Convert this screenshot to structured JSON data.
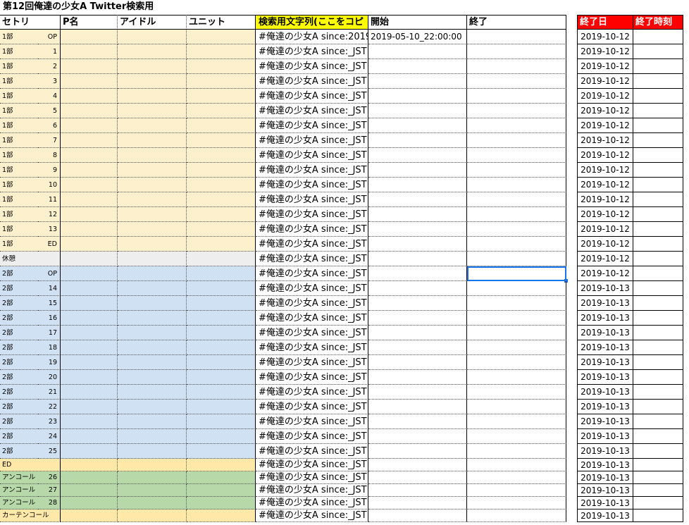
{
  "title": "第12回俺達の少女A Twitter検索用",
  "headers": {
    "setlist": "セトリ",
    "producer": "P名",
    "idol": "アイドル",
    "unit": "ユニット",
    "search": "検索用文字列(ここをコピ",
    "start": "開始",
    "end": "終了",
    "end_date": "終了日",
    "end_time": "終了時刻"
  },
  "search_first": "#俺達の少女A since:2019-",
  "search_rest": "#俺達の少女A since:_JST",
  "start_first": "2019-05-10_22:00:00",
  "rows": [
    {
      "part": "1部",
      "num": "OP",
      "band": "orange",
      "end_date": "2019-10-12"
    },
    {
      "part": "1部",
      "num": "1",
      "band": "orange",
      "end_date": "2019-10-12"
    },
    {
      "part": "1部",
      "num": "2",
      "band": "orange",
      "end_date": "2019-10-12"
    },
    {
      "part": "1部",
      "num": "3",
      "band": "orange",
      "end_date": "2019-10-12"
    },
    {
      "part": "1部",
      "num": "4",
      "band": "orange",
      "end_date": "2019-10-12"
    },
    {
      "part": "1部",
      "num": "5",
      "band": "orange",
      "end_date": "2019-10-12"
    },
    {
      "part": "1部",
      "num": "6",
      "band": "orange",
      "end_date": "2019-10-12"
    },
    {
      "part": "1部",
      "num": "7",
      "band": "orange",
      "end_date": "2019-10-12"
    },
    {
      "part": "1部",
      "num": "8",
      "band": "orange",
      "end_date": "2019-10-12"
    },
    {
      "part": "1部",
      "num": "9",
      "band": "orange",
      "end_date": "2019-10-12"
    },
    {
      "part": "1部",
      "num": "10",
      "band": "orange",
      "end_date": "2019-10-12"
    },
    {
      "part": "1部",
      "num": "11",
      "band": "orange",
      "end_date": "2019-10-12"
    },
    {
      "part": "1部",
      "num": "12",
      "band": "orange",
      "end_date": "2019-10-12"
    },
    {
      "part": "1部",
      "num": "13",
      "band": "orange",
      "end_date": "2019-10-12"
    },
    {
      "part": "1部",
      "num": "ED",
      "band": "orange",
      "end_date": "2019-10-12"
    },
    {
      "part": "休憩",
      "num": "",
      "band": "gray",
      "end_date": "2019-10-12"
    },
    {
      "part": "2部",
      "num": "OP",
      "band": "blue",
      "end_date": "2019-10-12"
    },
    {
      "part": "2部",
      "num": "14",
      "band": "blue",
      "end_date": "2019-10-13"
    },
    {
      "part": "2部",
      "num": "15",
      "band": "blue",
      "end_date": "2019-10-13"
    },
    {
      "part": "2部",
      "num": "16",
      "band": "blue",
      "end_date": "2019-10-13"
    },
    {
      "part": "2部",
      "num": "17",
      "band": "blue",
      "end_date": "2019-10-13"
    },
    {
      "part": "2部",
      "num": "18",
      "band": "blue",
      "end_date": "2019-10-13"
    },
    {
      "part": "2部",
      "num": "19",
      "band": "blue",
      "end_date": "2019-10-13"
    },
    {
      "part": "2部",
      "num": "20",
      "band": "blue",
      "end_date": "2019-10-13"
    },
    {
      "part": "2部",
      "num": "21",
      "band": "blue",
      "end_date": "2019-10-13"
    },
    {
      "part": "2部",
      "num": "22",
      "band": "blue",
      "end_date": "2019-10-13"
    },
    {
      "part": "2部",
      "num": "23",
      "band": "blue",
      "end_date": "2019-10-13"
    },
    {
      "part": "2部",
      "num": "24",
      "band": "blue",
      "end_date": "2019-10-13"
    },
    {
      "part": "2部",
      "num": "25",
      "band": "blue",
      "end_date": "2019-10-13"
    },
    {
      "part": "ED",
      "num": "",
      "band": "yellow",
      "end_date": "2019-10-13"
    },
    {
      "part": "アンコール",
      "num": "26",
      "band": "green",
      "end_date": "2019-10-13"
    },
    {
      "part": "アンコール",
      "num": "27",
      "band": "green",
      "end_date": "2019-10-13"
    },
    {
      "part": "アンコール",
      "num": "28",
      "band": "green",
      "end_date": "2019-10-13"
    },
    {
      "part": "カーテンコール",
      "num": "",
      "band": "yellow",
      "end_date": "2019-10-13"
    }
  ],
  "colors": {
    "orange": "#fdf0cc",
    "gray": "#eeeeee",
    "blue": "#d0e1f3",
    "green": "#b7d8a8",
    "yellow": "#ffe8a8",
    "header_red": "#ff0000",
    "header_yellow": "#ffff00",
    "selection": "#1a73e8"
  }
}
